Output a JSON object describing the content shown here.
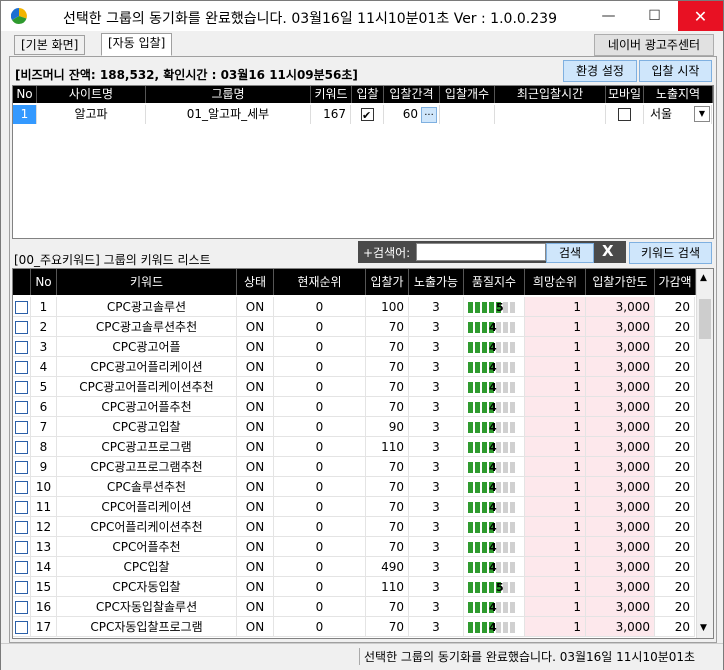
{
  "window": {
    "title": "선택한 그룹의 동기화를 완료했습니다. 03월16일 11시10분01초 Ver : 1.0.0.239"
  },
  "tabs": [
    {
      "label": "[기본 화면]"
    },
    {
      "label": "[자동 입찰]"
    }
  ],
  "header_buttons": {
    "naver": "네이버 광고주센터",
    "env": "환경 설정",
    "start": "입찰 시작"
  },
  "info": "[비즈머니 잔액: 188,532, 확인시간 : 03월16 11시09분56초]",
  "sites": {
    "headers": [
      "No",
      "사이트명",
      "그룹명",
      "키워드",
      "입찰",
      "입찰간격",
      "입찰개수",
      "최근입찰시간",
      "모바일",
      "노출지역"
    ],
    "rows": [
      {
        "no": "1",
        "site": "알고파",
        "group": "01_알고파_세부",
        "kw": "167",
        "bid": true,
        "interval": "60",
        "interval_btn": "...",
        "count": "",
        "recent": "",
        "mobile": false,
        "region": "서울"
      }
    ]
  },
  "list_label": "[00_주요키워드] 그룹의 키워드 리스트",
  "search": {
    "label": "+검색어:",
    "value": "",
    "button": "검색",
    "clear": "X",
    "kw_button": "키워드 검색"
  },
  "keywords": {
    "headers": [
      "No",
      "키워드",
      "상태",
      "현재순위",
      "입찰가",
      "노출가능",
      "품질지수",
      "희망순위",
      "입찰가한도",
      "가감액"
    ],
    "rows": [
      {
        "no": "1",
        "kw": "CPC광고솔루션",
        "status": "ON",
        "rank": "0",
        "bid": "100",
        "exp": "3",
        "q": 5,
        "want": "1",
        "limit": "3,000",
        "delta": "20"
      },
      {
        "no": "2",
        "kw": "CPC광고솔루션추천",
        "status": "ON",
        "rank": "0",
        "bid": "70",
        "exp": "3",
        "q": 4,
        "want": "1",
        "limit": "3,000",
        "delta": "20"
      },
      {
        "no": "3",
        "kw": "CPC광고어플",
        "status": "ON",
        "rank": "0",
        "bid": "70",
        "exp": "3",
        "q": 4,
        "want": "1",
        "limit": "3,000",
        "delta": "20"
      },
      {
        "no": "4",
        "kw": "CPC광고어플리케이션",
        "status": "ON",
        "rank": "0",
        "bid": "70",
        "exp": "3",
        "q": 4,
        "want": "1",
        "limit": "3,000",
        "delta": "20"
      },
      {
        "no": "5",
        "kw": "CPC광고어플리케이션추천",
        "status": "ON",
        "rank": "0",
        "bid": "70",
        "exp": "3",
        "q": 4,
        "want": "1",
        "limit": "3,000",
        "delta": "20"
      },
      {
        "no": "6",
        "kw": "CPC광고어플추천",
        "status": "ON",
        "rank": "0",
        "bid": "70",
        "exp": "3",
        "q": 4,
        "want": "1",
        "limit": "3,000",
        "delta": "20"
      },
      {
        "no": "7",
        "kw": "CPC광고입찰",
        "status": "ON",
        "rank": "0",
        "bid": "90",
        "exp": "3",
        "q": 4,
        "want": "1",
        "limit": "3,000",
        "delta": "20"
      },
      {
        "no": "8",
        "kw": "CPC광고프로그램",
        "status": "ON",
        "rank": "0",
        "bid": "110",
        "exp": "3",
        "q": 4,
        "want": "1",
        "limit": "3,000",
        "delta": "20"
      },
      {
        "no": "9",
        "kw": "CPC광고프로그램추천",
        "status": "ON",
        "rank": "0",
        "bid": "70",
        "exp": "3",
        "q": 4,
        "want": "1",
        "limit": "3,000",
        "delta": "20"
      },
      {
        "no": "10",
        "kw": "CPC솔루션추천",
        "status": "ON",
        "rank": "0",
        "bid": "70",
        "exp": "3",
        "q": 4,
        "want": "1",
        "limit": "3,000",
        "delta": "20"
      },
      {
        "no": "11",
        "kw": "CPC어플리케이션",
        "status": "ON",
        "rank": "0",
        "bid": "70",
        "exp": "3",
        "q": 4,
        "want": "1",
        "limit": "3,000",
        "delta": "20"
      },
      {
        "no": "12",
        "kw": "CPC어플리케이션추천",
        "status": "ON",
        "rank": "0",
        "bid": "70",
        "exp": "3",
        "q": 4,
        "want": "1",
        "limit": "3,000",
        "delta": "20"
      },
      {
        "no": "13",
        "kw": "CPC어플추천",
        "status": "ON",
        "rank": "0",
        "bid": "70",
        "exp": "3",
        "q": 4,
        "want": "1",
        "limit": "3,000",
        "delta": "20"
      },
      {
        "no": "14",
        "kw": "CPC입찰",
        "status": "ON",
        "rank": "0",
        "bid": "490",
        "exp": "3",
        "q": 4,
        "want": "1",
        "limit": "3,000",
        "delta": "20"
      },
      {
        "no": "15",
        "kw": "CPC자동입찰",
        "status": "ON",
        "rank": "0",
        "bid": "110",
        "exp": "3",
        "q": 5,
        "want": "1",
        "limit": "3,000",
        "delta": "20"
      },
      {
        "no": "16",
        "kw": "CPC자동입찰솔루션",
        "status": "ON",
        "rank": "0",
        "bid": "70",
        "exp": "3",
        "q": 4,
        "want": "1",
        "limit": "3,000",
        "delta": "20"
      },
      {
        "no": "17",
        "kw": "CPC자동입찰프로그램",
        "status": "ON",
        "rank": "0",
        "bid": "70",
        "exp": "3",
        "q": 4,
        "want": "1",
        "limit": "3,000",
        "delta": "20"
      }
    ]
  },
  "status_text": "선택한 그룹의 동기화를 완료했습니다. 03월16일 11시10분01초"
}
